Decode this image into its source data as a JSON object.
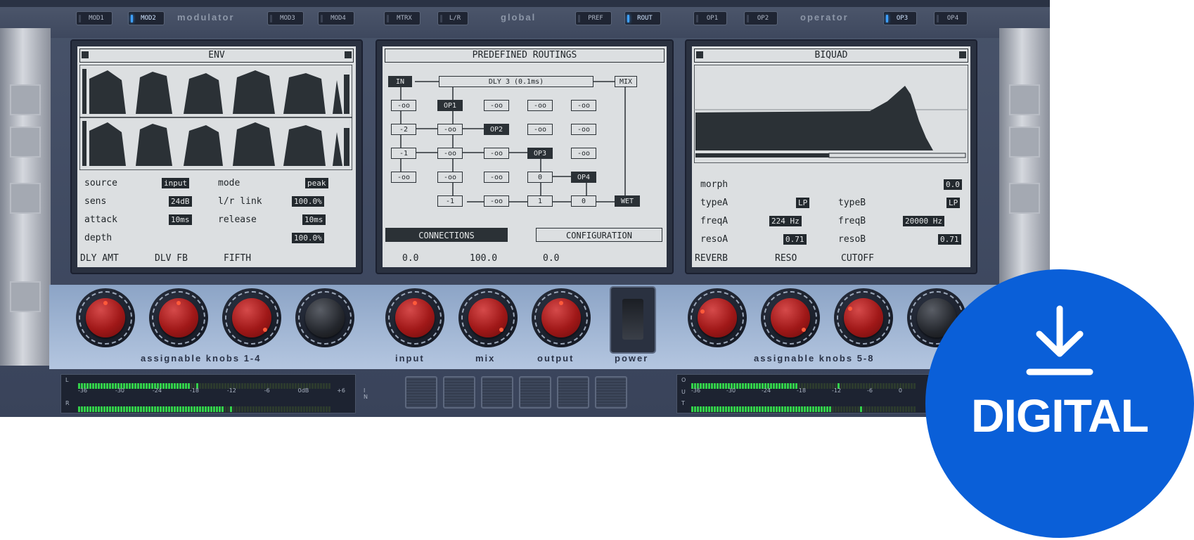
{
  "tabs": {
    "mod1": "MOD1",
    "mod2": "MOD2",
    "mod3": "MOD3",
    "mod4": "MOD4",
    "mtrx": "MTRX",
    "lr": "L/R",
    "pref": "PREF",
    "rout": "ROUT",
    "op1": "OP1",
    "op2": "OP2",
    "op3": "OP3",
    "op4": "OP4"
  },
  "groups": {
    "modulator": "modulator",
    "global": "global",
    "operator": "operator"
  },
  "env": {
    "title": "ENV",
    "params": [
      {
        "label": "source",
        "value": "input"
      },
      {
        "label": "mode",
        "value": "peak"
      },
      {
        "label": "sens",
        "value": "24dB"
      },
      {
        "label": "l/r link",
        "value": "100.0%"
      },
      {
        "label": "attack",
        "value": "10ms"
      },
      {
        "label": "release",
        "value": "10ms"
      },
      {
        "label": "depth",
        "value": "100.0%"
      }
    ],
    "knob_labels": [
      "DLY AMT",
      "DLV FB",
      "FIFTH"
    ]
  },
  "routing": {
    "title": "PREDEFINED ROUTINGS",
    "in": "IN",
    "dly": "DLY 3 (0.1ms)",
    "mix": "MIX",
    "wet": "WET",
    "op1": "OP1",
    "op2": "OP2",
    "op3": "OP3",
    "op4": "OP4",
    "inf": "-oo",
    "m2": "-2",
    "m1": "-1",
    "zero": "0",
    "one": "1",
    "connections": "CONNECTIONS",
    "configuration": "CONFIGURATION",
    "knob_values": [
      "0.0",
      "100.0",
      "0.0"
    ]
  },
  "biquad": {
    "title": "BIQUAD",
    "params": [
      {
        "label": "morph",
        "value": "0.0"
      },
      {
        "label": "typeA",
        "value": "LP"
      },
      {
        "label": "typeB",
        "value": "LP"
      },
      {
        "label": "freqA",
        "value": "224 Hz"
      },
      {
        "label": "freqB",
        "value": "20000 Hz"
      },
      {
        "label": "resoA",
        "value": "0.71"
      },
      {
        "label": "resoB",
        "value": "0.71"
      }
    ],
    "knob_labels": [
      "REVERB",
      "RESO",
      "CUTOFF"
    ]
  },
  "controls": {
    "knobs_1_4": "assignable knobs 1-4",
    "input": "input",
    "mix": "mix",
    "output": "output",
    "power": "power",
    "knobs_5_8": "assignable knobs 5-8"
  },
  "meter_in": {
    "ch_top": "L",
    "ch_bottom": "R",
    "side": "I N",
    "scale": [
      "-36",
      "-30",
      "-24",
      "-18",
      "-12",
      "-6",
      "0dB",
      "+6"
    ]
  },
  "meter_out": {
    "ch_top": "O",
    "ch_mid": "U",
    "ch_bottom": "T",
    "scale": [
      "-36",
      "-30",
      "-24",
      "-18",
      "-12",
      "-6",
      "0"
    ]
  },
  "badge": {
    "label": "DIGITAL",
    "icon": "download-icon"
  },
  "colors": {
    "accent": "#3ea0ff",
    "badge": "#0a5fd8",
    "knob_red": "#a01818",
    "meter_green": "#33d14a"
  }
}
